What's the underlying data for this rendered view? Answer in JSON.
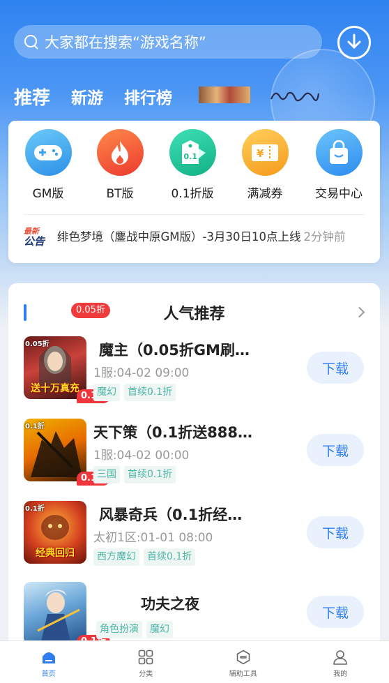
{
  "search": {
    "placeholder_text": "大家都在搜索“游戏名称”"
  },
  "tabs": [
    {
      "label": "推荐",
      "active": true
    },
    {
      "label": "新游",
      "active": false
    },
    {
      "label": "排行榜",
      "active": false
    }
  ],
  "categories": [
    {
      "label": "GM版",
      "icon": "gamepad-icon",
      "color": "#3fa8f2"
    },
    {
      "label": "BT版",
      "icon": "flame-icon",
      "color": "#f2553a"
    },
    {
      "label": "0.1折版",
      "icon": "discount-tag-icon",
      "color": "#22c29a"
    },
    {
      "label": "满减券",
      "icon": "coupon-icon",
      "color": "#f5a623"
    },
    {
      "label": "交易中心",
      "icon": "shopping-bag-icon",
      "color": "#3f9ef5"
    }
  ],
  "notice": {
    "badge_top": "最新",
    "badge_bottom": "公告",
    "text": "绯色梦境（鏖战中原GM版）-3月30日10点上线",
    "time": "2分钟前"
  },
  "section": {
    "tag": "0.05折",
    "title": "人气推荐"
  },
  "games": [
    {
      "name": "魔主（0.05折GM刷…",
      "sub": "1服:04-02 09:00",
      "tags": [
        "魔幻",
        "首续0.1折"
      ],
      "discount": "0.1折",
      "thumb_text": "送十万真充",
      "thumb_corner": "0.05折",
      "button": "下载"
    },
    {
      "name": "天下策（0.1折送888…",
      "sub": "1服:04-02 00:00",
      "tags": [
        "三国",
        "首续0.1折"
      ],
      "discount": "0.1折",
      "thumb_text": "",
      "thumb_corner": "0.1折",
      "button": "下载"
    },
    {
      "name": "风暴奇兵（0.1折经…",
      "sub": "太初1区:01-01 08:00",
      "tags": [
        "西方魔幻",
        "首续0.1折"
      ],
      "discount": "",
      "thumb_text": "经典回归",
      "thumb_corner": "0.1折",
      "button": "下载"
    },
    {
      "name": "功夫之夜",
      "sub": "",
      "tags": [
        "角色扮演",
        "魔幻"
      ],
      "discount": "0.1折",
      "thumb_text": "",
      "thumb_corner": "",
      "button": "下载"
    }
  ],
  "bottom_nav": [
    {
      "label": "首页",
      "icon": "home-icon",
      "active": true
    },
    {
      "label": "分类",
      "icon": "grid-icon",
      "active": false
    },
    {
      "label": "辅助工具",
      "icon": "tools-icon",
      "active": false
    },
    {
      "label": "我的",
      "icon": "user-icon",
      "active": false
    }
  ],
  "colors": {
    "primary": "#2f7df0",
    "discount_red": "#f0363d",
    "tag_green": "#4db6a6"
  }
}
